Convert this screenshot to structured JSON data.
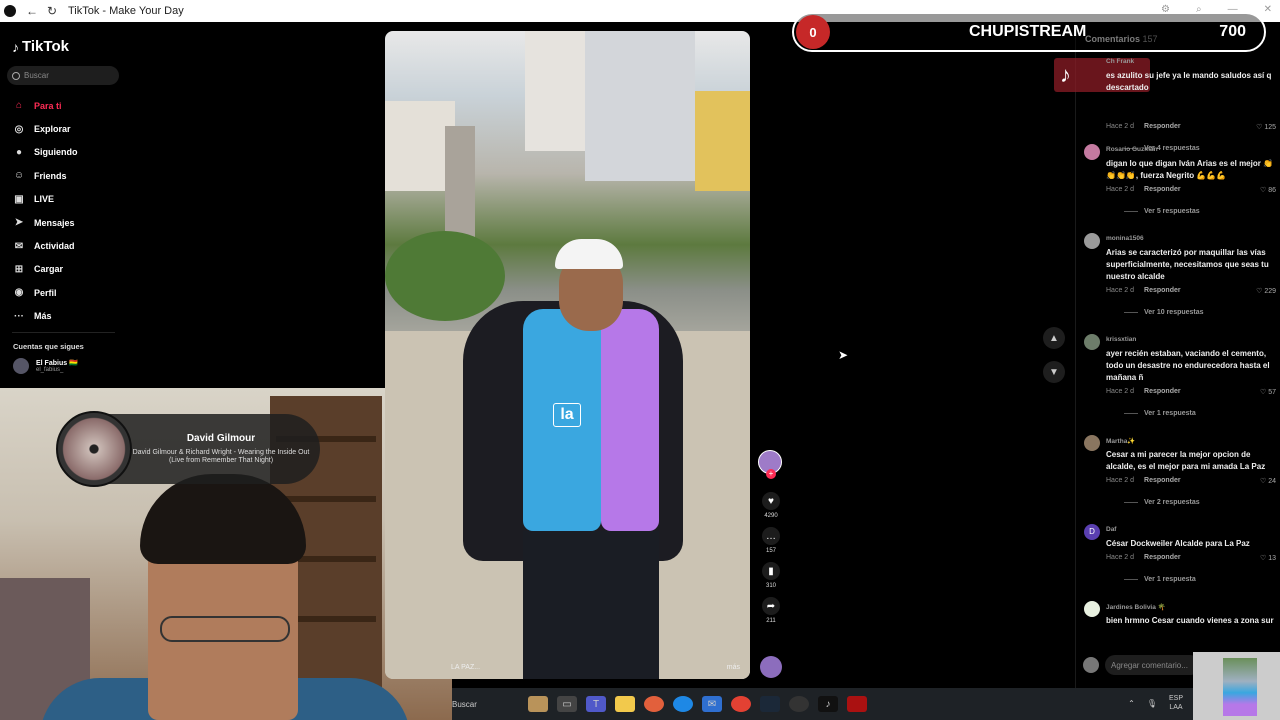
{
  "window": {
    "title": "TikTok - Make Your Day"
  },
  "sidebar": {
    "logo": "TikTok",
    "search_placeholder": "Buscar",
    "items": [
      {
        "label": "Para ti",
        "icon": "home-icon",
        "active": true
      },
      {
        "label": "Explorar",
        "icon": "compass-icon"
      },
      {
        "label": "Siguiendo",
        "icon": "following-icon"
      },
      {
        "label": "Friends",
        "icon": "friends-icon"
      },
      {
        "label": "LIVE",
        "icon": "live-icon"
      },
      {
        "label": "Mensajes",
        "icon": "messages-icon"
      },
      {
        "label": "Actividad",
        "icon": "activity-icon"
      },
      {
        "label": "Cargar",
        "icon": "upload-icon"
      },
      {
        "label": "Perfil",
        "icon": "profile-icon"
      },
      {
        "label": "Más",
        "icon": "more-icon"
      }
    ],
    "following_title": "Cuentas que sigues",
    "following": [
      {
        "name": "El Fabius 🇧🇴",
        "handle": "el_fabius_"
      }
    ]
  },
  "music_toast": {
    "artist": "David Gilmour",
    "song": "David Gilmour & Richard Wright - Wearing the Inside Out (Live from Remember That Night)"
  },
  "video": {
    "caption": "LA PAZ...",
    "more": "más",
    "vest_label": "la"
  },
  "actions": {
    "likes": "4290",
    "comments": "157",
    "saves": "310",
    "shares": "211"
  },
  "overlay": {
    "counter": "0",
    "name": "CHUPISTREAM",
    "goal": "700"
  },
  "comments": {
    "title": "Comentarios",
    "count": "157",
    "input_placeholder": "Agregar comentario...",
    "items": [
      {
        "user": "Ch Frank",
        "text": "es azulito su jefe ya le mando saludos así q descartado",
        "time": "Hace 2 d",
        "reply": "Responder",
        "likes": "125",
        "more": "Ver 4 respuestas"
      },
      {
        "user": "Rosario Guzmán",
        "text": "digan lo que digan Iván Arias es el mejor 👏👏👏👏, fuerza Negrito 💪💪💪",
        "time": "Hace 2 d",
        "reply": "Responder",
        "likes": "86",
        "more": "Ver 5 respuestas"
      },
      {
        "user": "monina1506",
        "text": "Arias se caracterizó por maquillar las vías superficialmente, necesitamos que seas tu nuestro alcalde",
        "time": "Hace 2 d",
        "reply": "Responder",
        "likes": "229",
        "more": "Ver 10 respuestas"
      },
      {
        "user": "krissxtian",
        "text": "ayer recién estaban, vaciando el cemento, todo un desastre no endurecedora hasta el mañana ñ",
        "time": "Hace 2 d",
        "reply": "Responder",
        "likes": "57",
        "more": "Ver 1 respuesta"
      },
      {
        "user": "Martha✨",
        "text": "Cesar a mi parecer la mejor opcion de alcalde, es el mejor para mi amada La Paz",
        "time": "Hace 2 d",
        "reply": "Responder",
        "likes": "24",
        "more": "Ver 2 respuestas"
      },
      {
        "user": "Daf",
        "text": "César Dockweiler Alcalde para La Paz",
        "time": "Hace 2 d",
        "reply": "Responder",
        "likes": "13",
        "more": "Ver 1 respuesta"
      },
      {
        "user": "Jardines Bolivia 🌴",
        "text": "bien hrmno Cesar cuando vienes a zona sur",
        "time": "",
        "reply": "",
        "likes": "",
        "more": ""
      }
    ]
  },
  "taskbar": {
    "search": "Buscar",
    "lang1": "ESP",
    "lang2": "LAA"
  },
  "colors": {
    "accent": "#fe2c55",
    "stream_red": "#c62828"
  }
}
